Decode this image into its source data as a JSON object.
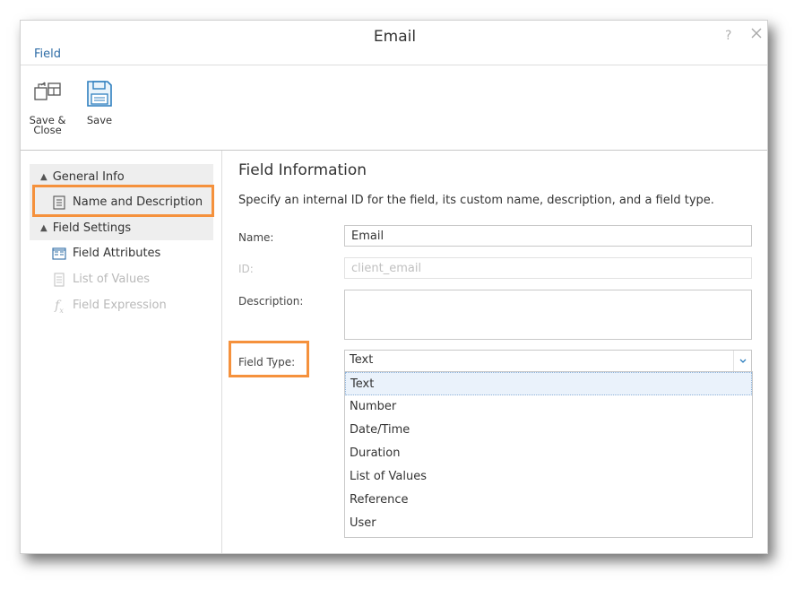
{
  "dialog": {
    "title": "Email",
    "help_glyph": "?",
    "ribbon_tab": "Field"
  },
  "toolbar": {
    "save_close_label_line1": "Save &",
    "save_close_label_line2": "Close",
    "save_label": "Save"
  },
  "sidebar": {
    "groups": [
      {
        "label": "General Info",
        "items": [
          {
            "label": "Name and Description",
            "icon": "document-icon",
            "selected": true,
            "disabled": false
          }
        ]
      },
      {
        "label": "Field Settings",
        "items": [
          {
            "label": "Field Attributes",
            "icon": "attributes-icon",
            "disabled": false
          },
          {
            "label": "List of Values",
            "icon": "list-icon",
            "disabled": true
          },
          {
            "label": "Field Expression",
            "icon": "function-icon",
            "disabled": true
          }
        ]
      }
    ]
  },
  "form": {
    "section_title": "Field Information",
    "description": "Specify an internal ID for the field, its custom name, description, and a field type.",
    "name_label": "Name:",
    "name_value": "Email",
    "id_label": "ID:",
    "id_value": "client_email",
    "description_label": "Description:",
    "description_value": "",
    "field_type_label": "Field Type:",
    "field_type_value": "Text",
    "field_type_options": [
      "Text",
      "Number",
      "Date/Time",
      "Duration",
      "List of Values",
      "Reference",
      "User"
    ]
  },
  "colors": {
    "accent": "#2e6ca6",
    "highlight": "#f5913c",
    "disabled": "#b9b9b9"
  }
}
